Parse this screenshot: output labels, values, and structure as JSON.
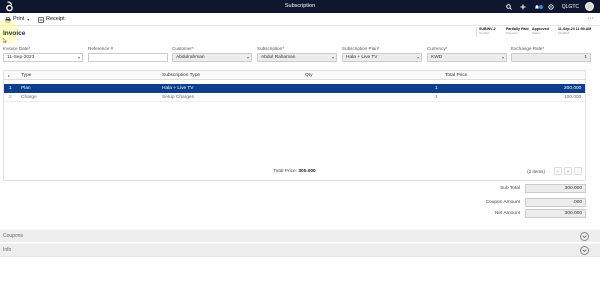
{
  "app": {
    "title": "Subscription",
    "org": "QLGTC",
    "notifications_count": "",
    "icons": [
      "logo-icon",
      "search-icon",
      "plus-icon",
      "bell-icon",
      "gear-icon",
      "avatar"
    ]
  },
  "toolbar": {
    "print_label": "Print",
    "receipt_label": "Receipt",
    "more_label": "···"
  },
  "document": {
    "title": "Invoice"
  },
  "status": [
    {
      "value": "SUBINV-2",
      "label": "Number"
    },
    {
      "value": "Partially Paid",
      "label": "Payment"
    },
    {
      "value": "Approved",
      "label": "Status"
    },
    {
      "value": "11-Sep-23 11:58 AM",
      "label": "Modified"
    }
  ],
  "fields": {
    "invoice_date": {
      "label": "Invoice Date*",
      "value": "11-Sep-2023"
    },
    "reference": {
      "label": "Reference #",
      "value": ""
    },
    "customer": {
      "label": "Customer*",
      "value": "Abdulrahman"
    },
    "subscription": {
      "label": "Subscription*",
      "value": "Abdul Rahaman"
    },
    "subscription_plan": {
      "label": "Subscription Plan*",
      "value": "Hala + Live TV"
    },
    "currency": {
      "label": "Currency*",
      "value": "KWD"
    },
    "exchange_rate": {
      "label": "Exchange Rate*",
      "value": "1"
    }
  },
  "grid": {
    "columns": [
      "Type",
      "Subscription Type",
      "Qty",
      "Total Price"
    ],
    "rows": [
      {
        "index": "1",
        "type": "Plan",
        "subscription_type": "Hala + Live TV",
        "qty": "1",
        "total": "200.000"
      },
      {
        "index": "2",
        "type": "Charge",
        "subscription_type": "Setup Charges",
        "qty": "1",
        "total": "100.000"
      }
    ],
    "footer_label": "Total Price:",
    "footer_value": "300.000",
    "items_count": "(2 items)"
  },
  "totals": {
    "sub_total": {
      "label": "Sub Total",
      "value": "300.000"
    },
    "coupon_amount": {
      "label": "Coupon Amount",
      "value": ".000"
    },
    "net_amount": {
      "label": "Net Amount",
      "value": "300.000"
    }
  },
  "sections": {
    "coupons": "Coupons",
    "info": "Info"
  },
  "colors": {
    "topbar": "#0f1730",
    "selected_row": "#0d3e8c",
    "accent": "#1a2a56"
  }
}
